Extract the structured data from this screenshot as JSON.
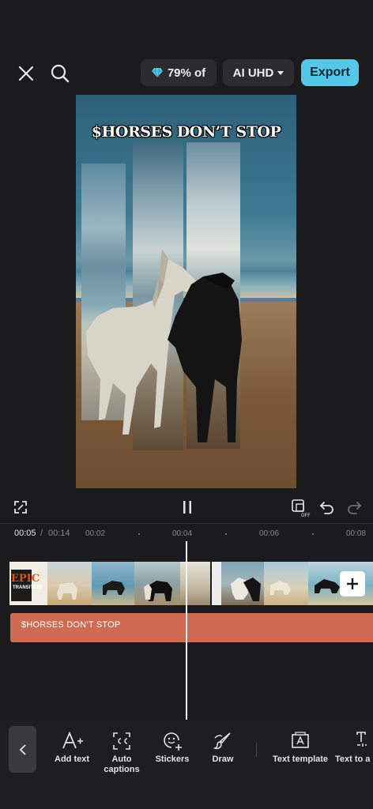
{
  "header": {
    "storage_label": "79% of",
    "quality_label": "AI UHD",
    "export_label": "Export"
  },
  "preview": {
    "caption": "$HORSES DON’T STOP"
  },
  "timeline": {
    "current_time": "00:05",
    "separator": "/",
    "total_time": "00:14",
    "ticks": [
      "00:02",
      "00:04",
      "00:06",
      "00:08"
    ],
    "first_clip_text_top": "EPIC",
    "first_clip_text_bottom": "TRANSITION",
    "text_track_label": "$HORSES DON’T STOP"
  },
  "toolbar": {
    "items": [
      {
        "label": "Add text",
        "icon": "add-text-icon"
      },
      {
        "label": "Auto captions",
        "icon": "auto-captions-icon"
      },
      {
        "label": "Stickers",
        "icon": "stickers-icon"
      },
      {
        "label": "Draw",
        "icon": "draw-icon"
      },
      {
        "label": "Text template",
        "icon": "text-template-icon"
      },
      {
        "label": "Text to a",
        "icon": "text-to-audio-icon"
      }
    ]
  },
  "colors": {
    "accent": "#55c7e8",
    "text_track": "#d06b53",
    "diamond": "#5cc8ec"
  }
}
